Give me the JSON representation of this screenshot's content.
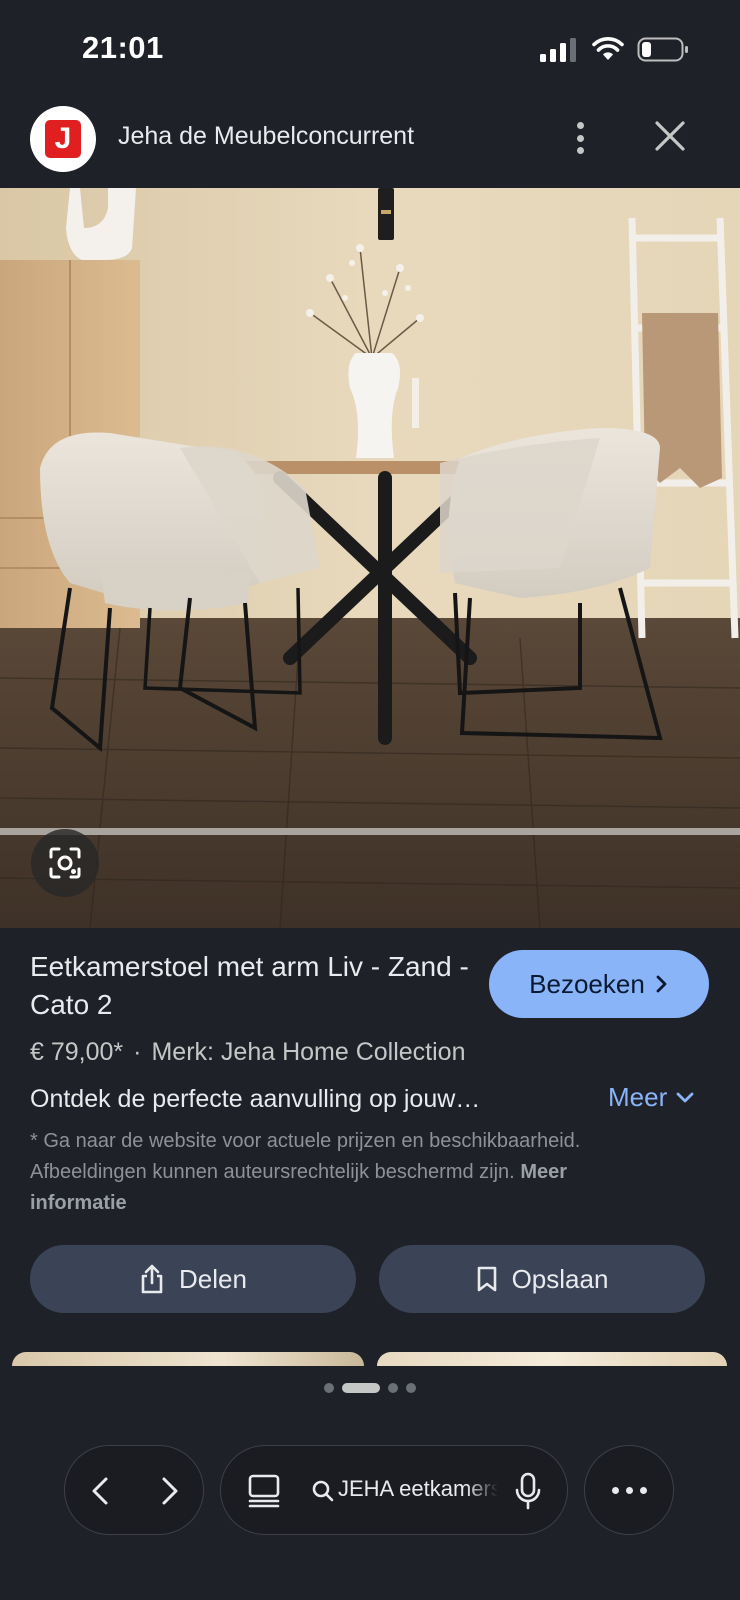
{
  "status_bar": {
    "time": "21:01"
  },
  "header": {
    "logo_letter": "J",
    "site_name": "Jeha de Meubelconcurrent",
    "more_icon": "kebab-icon",
    "close_icon": "close-icon"
  },
  "product": {
    "title": "Eetkamerstoel met arm Liv - Zand - Cato 2",
    "visit_label": "Bezoeken",
    "price": "€ 79,00*",
    "separator": "·",
    "brand": "Merk: Jeha Home Collection",
    "description": "Ontdek de perfecte aanvulling op jouw…",
    "more_label": "Meer",
    "disclaimer": "* Ga naar de website voor actuele prijzen en beschikbaarheid. Afbeeldingen kunnen auteursrechtelijk beschermd zijn.",
    "more_info_label": "Meer informatie"
  },
  "actions": {
    "share_label": "Delen",
    "save_label": "Opslaan"
  },
  "pager": {
    "count": 4,
    "active_index": 1
  },
  "toolbar": {
    "search_query": "JEHA eetkamerstoel"
  },
  "colors": {
    "background": "#1f2128",
    "accent": "#8ab4f8",
    "action_button": "#3a4456",
    "logo_red": "#e02020"
  }
}
